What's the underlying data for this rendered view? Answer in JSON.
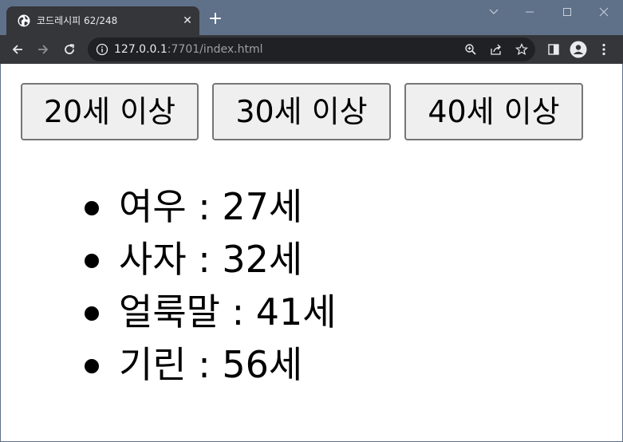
{
  "browser": {
    "tab": {
      "title": "코드레시피 62/248",
      "favicon": "globe-icon"
    },
    "new_tab_label": "+",
    "window_controls": [
      "chevron-down-icon",
      "minimize-icon",
      "maximize-icon",
      "close-icon"
    ],
    "url": {
      "host": "127.0.0.1",
      "rest": ":7701/index.html"
    },
    "toolbar_icons": [
      "back-arrow-icon",
      "forward-arrow-icon",
      "reload-icon",
      "info-icon",
      "zoom-icon",
      "share-icon",
      "star-icon",
      "side-panel-icon",
      "profile-icon",
      "more-menu-icon"
    ],
    "colors": {
      "titlebar": "#5f7089",
      "tab": "#35363a",
      "toolbar": "#35363a",
      "omnibox": "#202124"
    }
  },
  "page": {
    "buttons": [
      {
        "label": "20세 이상"
      },
      {
        "label": "30세 이상"
      },
      {
        "label": "40세 이상"
      }
    ],
    "animals": [
      {
        "text": "여우 : 27세"
      },
      {
        "text": "사자 : 32세"
      },
      {
        "text": "얼룩말 : 41세"
      },
      {
        "text": "기린 : 56세"
      }
    ]
  }
}
